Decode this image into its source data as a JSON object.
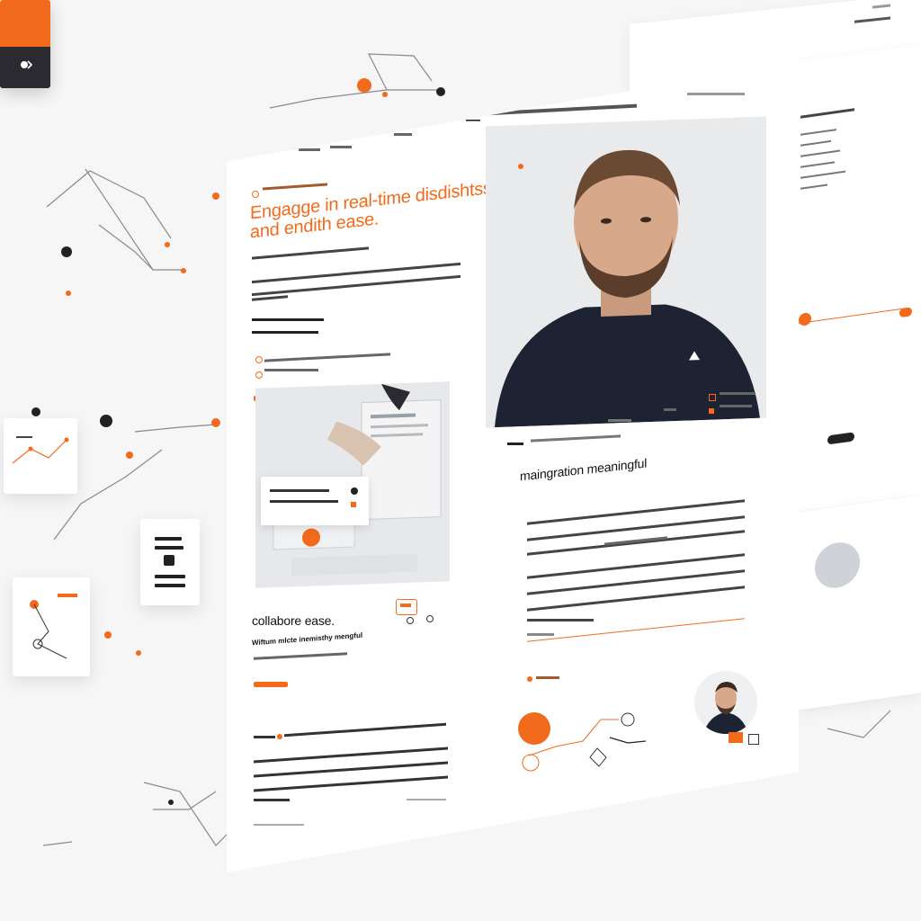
{
  "hero": {
    "title_line1": "Engagge in real-time disdishtss,",
    "title_line2": "and endith ease."
  },
  "content": {
    "section_heading": "maingration meaningful"
  },
  "collab": {
    "heading": "collabore ease.",
    "subheading": "Wiftum mlcte inemisthy mengful"
  },
  "colors": {
    "accent": "#f26a1b",
    "dark": "#2a2a30",
    "background": "#f6f6f7",
    "text": "#222222"
  },
  "icons": {
    "logo": "arrow-mark-icon",
    "menu": "hamburger-icon",
    "link": "chain-link-icon",
    "user": "user-icon",
    "play": "play-icon"
  }
}
